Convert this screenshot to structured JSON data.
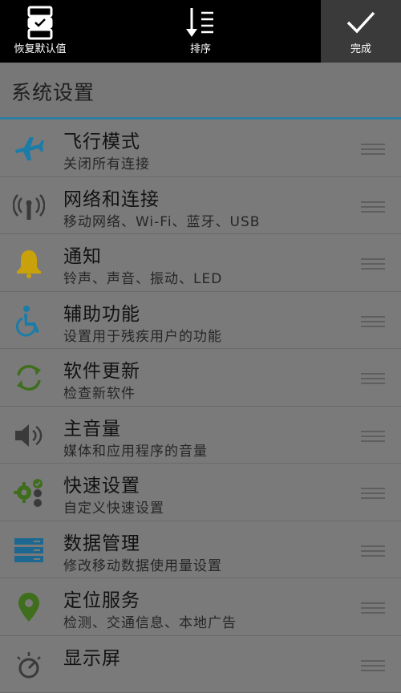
{
  "toolbar": {
    "restore_label": "恢复默认值",
    "sort_label": "排序",
    "done_label": "完成"
  },
  "section": {
    "title": "系统设置"
  },
  "items": [
    {
      "title": "飞行模式",
      "subtitle": "关闭所有连接",
      "icon": "airplane-icon"
    },
    {
      "title": "网络和连接",
      "subtitle": "移动网络、Wi-Fi、蓝牙、USB",
      "icon": "antenna-icon"
    },
    {
      "title": "通知",
      "subtitle": "铃声、声音、振动、LED",
      "icon": "bell-icon"
    },
    {
      "title": "辅助功能",
      "subtitle": "设置用于残疾用户的功能",
      "icon": "accessibility-icon"
    },
    {
      "title": "软件更新",
      "subtitle": "检查新软件",
      "icon": "refresh-icon"
    },
    {
      "title": "主音量",
      "subtitle": "媒体和应用程序的音量",
      "icon": "speaker-icon"
    },
    {
      "title": "快速设置",
      "subtitle": "自定义快速设置",
      "icon": "quick-settings-icon"
    },
    {
      "title": "数据管理",
      "subtitle": "修改移动数据使用量设置",
      "icon": "data-storage-icon"
    },
    {
      "title": "定位服务",
      "subtitle": "检测、交通信息、本地广告",
      "icon": "location-pin-icon"
    },
    {
      "title": "显示屏",
      "subtitle": "",
      "icon": "brightness-icon"
    }
  ],
  "colors": {
    "accent": "#2e7ea0",
    "overlay_background": "#7a7a7a",
    "toolbar_background": "#000000"
  }
}
